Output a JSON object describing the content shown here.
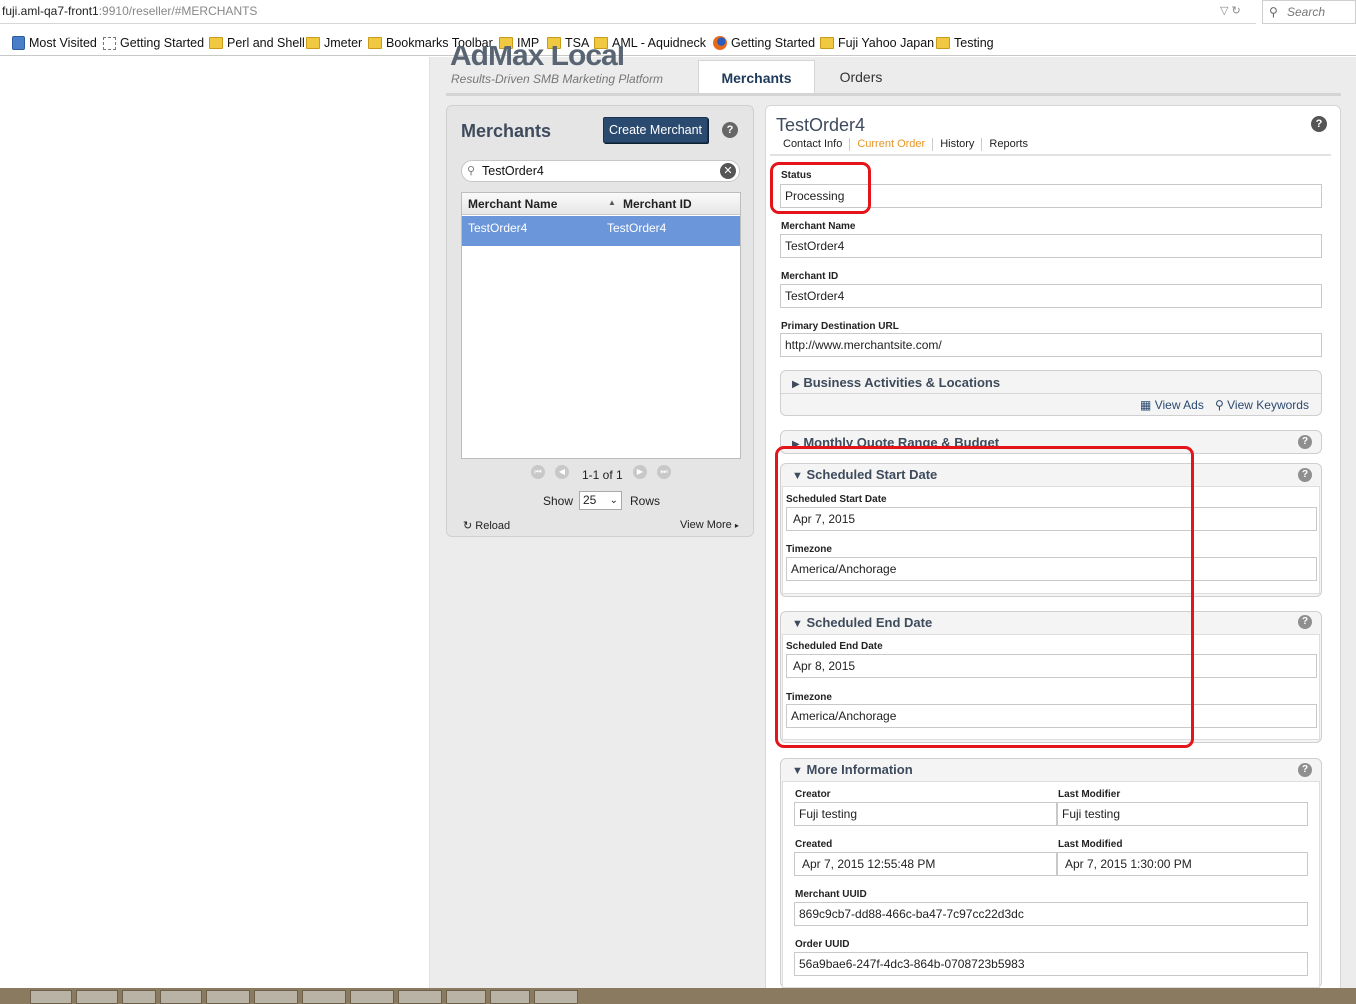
{
  "browser": {
    "url_host": "fuji.aml-qa7-front1",
    "url_rest": ":9910/reseller/#MERCHANTS",
    "search_placeholder": "Search",
    "bookmarks": [
      "Most Visited",
      "Getting Started",
      "Perl and Shell",
      "Jmeter",
      "Bookmarks Toolbar",
      "IMP",
      "TSA",
      "AML - Aquidneck",
      "Getting Started",
      "Fuji Yahoo Japan",
      "Testing"
    ]
  },
  "app": {
    "logo": "AdMax Local",
    "tagline": "Results-Driven SMB Marketing Platform",
    "tabs": [
      "Merchants",
      "Orders"
    ]
  },
  "merchants_panel": {
    "title": "Merchants",
    "create_button": "Create Merchant",
    "search_value": "TestOrder4",
    "columns": [
      "Merchant Name",
      "Merchant ID"
    ],
    "rows": [
      {
        "name": "TestOrder4",
        "id": "TestOrder4"
      }
    ],
    "paging": "1-1 of 1",
    "show_label": "Show",
    "rows_per_page": "25",
    "rows_label": "Rows",
    "reload": "Reload",
    "view_more": "View More"
  },
  "detail": {
    "title": "TestOrder4",
    "subtabs": [
      "Contact Info",
      "Current Order",
      "History",
      "Reports"
    ],
    "active_subtab": "Current Order",
    "status_label": "Status",
    "status_value": "Processing",
    "merchant_name_label": "Merchant Name",
    "merchant_name_value": "TestOrder4",
    "merchant_id_label": "Merchant ID",
    "merchant_id_value": "TestOrder4",
    "url_label": "Primary Destination URL",
    "url_value": "http://www.merchantsite.com/",
    "business_section": "Business Activities & Locations",
    "view_ads": "View Ads",
    "view_keywords": "View Keywords",
    "budget_section": "Monthly Quote Range & Budget",
    "start_section": "Scheduled Start Date",
    "start_date_label": "Scheduled Start Date",
    "start_date_value": "Apr 7, 2015",
    "start_tz_label": "Timezone",
    "start_tz_value": "America/Anchorage",
    "end_section": "Scheduled End Date",
    "end_date_label": "Scheduled End Date",
    "end_date_value": "Apr 8, 2015",
    "end_tz_label": "Timezone",
    "end_tz_value": "America/Anchorage",
    "more_section": "More Information",
    "creator_label": "Creator",
    "creator_value": "Fuji testing",
    "last_modifier_label": "Last Modifier",
    "last_modifier_value": "Fuji testing",
    "created_label": "Created",
    "created_value": "Apr 7, 2015 12:55:48 PM",
    "last_modified_label": "Last Modified",
    "last_modified_value": "Apr 7, 2015 1:30:00 PM",
    "merchant_uuid_label": "Merchant UUID",
    "merchant_uuid_value": "869c9cb7-dd88-466c-ba47-7c97cc22d3dc",
    "order_uuid_label": "Order UUID",
    "order_uuid_value": "56a9bae6-247f-4dc3-864b-0708723b5983"
  },
  "colors": {
    "brand_dark": "#2b4a6f",
    "selected_row": "#6b96d9",
    "active_subtab": "#e79628",
    "highlight": "#e3151b"
  }
}
